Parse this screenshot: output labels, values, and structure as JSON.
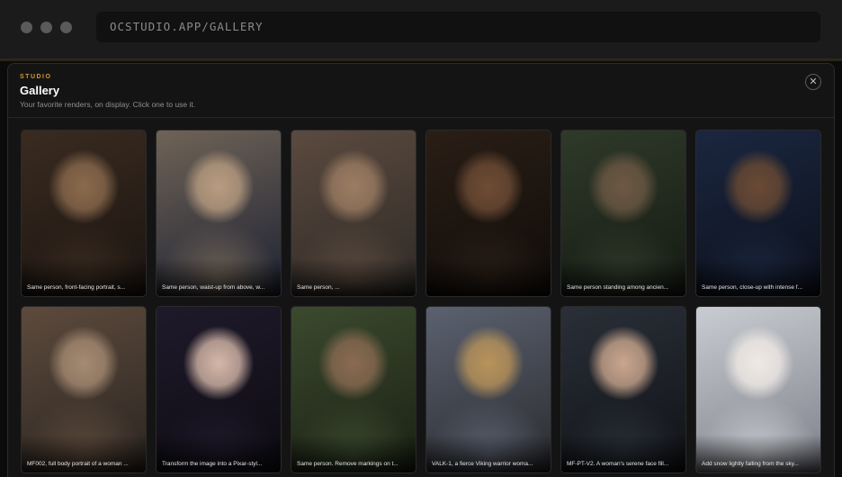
{
  "browser": {
    "url": "OCSTUDIO.APP/GALLERY"
  },
  "modal": {
    "eyebrow": "STUDIO",
    "title": "Gallery",
    "subtitle": "Your favorite renders, on display. Click one to use it.",
    "close_glyph": "✕"
  },
  "gallery": {
    "items": [
      {
        "caption": "Same person, front-facing portrait, s...",
        "palette": [
          "#3a2b20",
          "#1a1410",
          "#8a6a4d"
        ]
      },
      {
        "caption": "Same person, waist-up from above, w...",
        "palette": [
          "#6f6356",
          "#1d2233",
          "#b89c80"
        ]
      },
      {
        "caption": "Same person, ...",
        "palette": [
          "#5b4a3f",
          "#2e2a26",
          "#9b7c62"
        ]
      },
      {
        "caption": "",
        "palette": [
          "#2a1e16",
          "#0f0c09",
          "#6e4c35"
        ]
      },
      {
        "caption": "Same person standing among ancien...",
        "palette": [
          "#2f3a2a",
          "#141a12",
          "#6d5844"
        ]
      },
      {
        "caption": "Same person, close-up with intense f...",
        "palette": [
          "#1b2740",
          "#0b0f1a",
          "#6a4a34"
        ]
      },
      {
        "caption": "MF002, full body portrait of a woman ...",
        "palette": [
          "#5d4a3c",
          "#2a2521",
          "#a58a72"
        ]
      },
      {
        "caption": "Transform the image into a Pixar-styl...",
        "palette": [
          "#1f1a2b",
          "#0d0b12",
          "#d4b7a8"
        ]
      },
      {
        "caption": "Same person. Remove markings on t...",
        "palette": [
          "#3b4a2e",
          "#1a2014",
          "#8a6a52"
        ]
      },
      {
        "caption": "VALK-1, a fierce Viking warrior woma...",
        "palette": [
          "#5b6170",
          "#2a2b2e",
          "#b8935a"
        ]
      },
      {
        "caption": "MF-PT-V2. A woman's serene face fill...",
        "palette": [
          "#2a2f38",
          "#101216",
          "#c9a68e"
        ]
      },
      {
        "caption": "Add snow lightly falling from the sky...",
        "palette": [
          "#c9ccd2",
          "#7d8089",
          "#efe9e4"
        ]
      }
    ]
  }
}
